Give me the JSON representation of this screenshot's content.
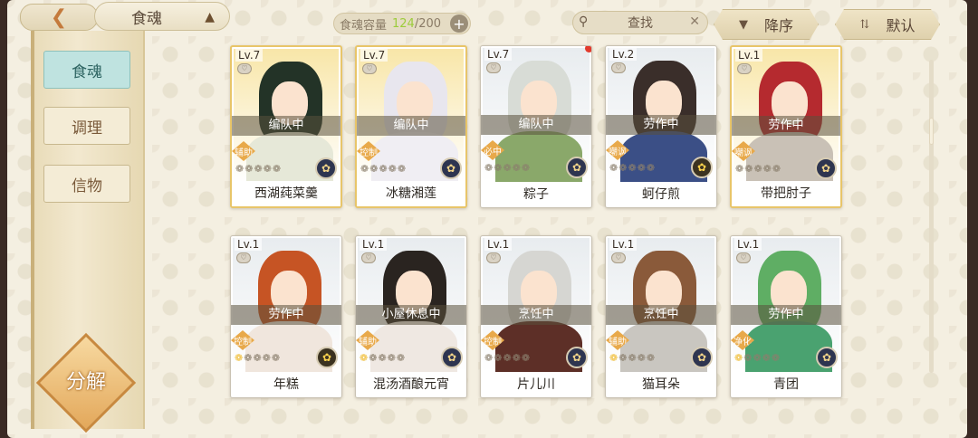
{
  "header": {
    "back_icon": "chevron-back-icon",
    "title": "食魂",
    "crown_icon": "crown-icon",
    "capacity_label": "食魂容量",
    "capacity_current": "124",
    "capacity_max": "/200",
    "add_icon": "plus-icon",
    "search_placeholder": "查找",
    "search_icon": "magnifier-icon",
    "clear_icon": "close-icon",
    "sort_label": "降序",
    "filter_label": "默认"
  },
  "sidebar": {
    "items": [
      {
        "label": "食魂",
        "active": true
      },
      {
        "label": "调理",
        "active": false
      },
      {
        "label": "信物",
        "active": false
      }
    ],
    "decompose_label": "分解"
  },
  "cards": [
    {
      "level": "Lv.7",
      "status": "编队中",
      "role": "辅助",
      "name": "西湖莼菜羹",
      "stars": 0,
      "element_icon": "element-icon",
      "frame": "gold",
      "new": false,
      "hair": "#233327",
      "body": "#e6e8d8"
    },
    {
      "level": "Lv.7",
      "status": "编队中",
      "role": "控制",
      "name": "冰糖湘莲",
      "stars": 0,
      "element_icon": "element-icon",
      "frame": "gold",
      "new": false,
      "hair": "#e8e6ee",
      "body": "#f0eef3"
    },
    {
      "level": "Lv.7",
      "status": "编队中",
      "role": "必中",
      "name": "粽子",
      "stars": 0,
      "element_icon": "element-icon",
      "frame": "normal",
      "new": true,
      "hair": "#d8dcd6",
      "body": "#8aa86a"
    },
    {
      "level": "Lv.2",
      "status": "劳作中",
      "role": "嘲讽",
      "name": "蚵仔煎",
      "stars": 0,
      "element_icon": "gold-element-icon",
      "frame": "normal",
      "new": false,
      "hair": "#3a2e2a",
      "body": "#3b4f86"
    },
    {
      "level": "Lv.1",
      "status": "劳作中",
      "role": "嘲讽",
      "name": "带把肘子",
      "stars": 0,
      "element_icon": "element-icon",
      "frame": "gold",
      "new": false,
      "hair": "#b52a2f",
      "body": "#c9c1b6"
    },
    {
      "level": "Lv.1",
      "status": "劳作中",
      "role": "控制",
      "name": "年糕",
      "stars": 1,
      "element_icon": "gold-element-icon",
      "frame": "normal",
      "new": false,
      "hair": "#c65424",
      "body": "#f0e6dd"
    },
    {
      "level": "Lv.1",
      "status": "小屋休息中",
      "role": "辅助",
      "name": "混汤酒酿元宵",
      "stars": 1,
      "element_icon": "element-icon",
      "frame": "normal",
      "new": false,
      "hair": "#2a2420",
      "body": "#efe8e2"
    },
    {
      "level": "Lv.1",
      "status": "烹饪中",
      "role": "控制",
      "name": "片儿川",
      "stars": 0,
      "element_icon": "element-icon",
      "frame": "normal",
      "new": false,
      "hair": "#d6d6d2",
      "body": "#5d2f27"
    },
    {
      "level": "Lv.1",
      "status": "烹饪中",
      "role": "辅助",
      "name": "猫耳朵",
      "stars": 1,
      "element_icon": "element-icon",
      "frame": "normal",
      "new": false,
      "hair": "#8a5a3a",
      "body": "#c9c6c0"
    },
    {
      "level": "Lv.1",
      "status": "劳作中",
      "role": "净化",
      "name": "青团",
      "stars": 1,
      "element_icon": "element-icon",
      "frame": "normal",
      "new": false,
      "hair": "#5fae64",
      "body": "#4aa270"
    }
  ]
}
